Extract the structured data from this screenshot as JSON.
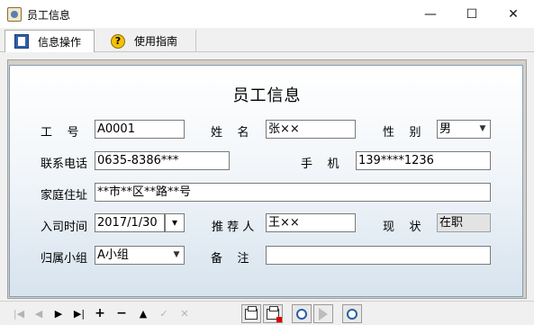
{
  "window": {
    "title": "员工信息",
    "minimize": "—",
    "maximize": "☐",
    "close": "✕"
  },
  "tabs": [
    {
      "label": "信息操作",
      "icon": "book-icon"
    },
    {
      "label": "使用指南",
      "icon": "help-icon",
      "glyph": "?"
    }
  ],
  "form": {
    "title": "员工信息",
    "labels": {
      "emp_id": "工    号",
      "name": "姓    名",
      "gender": "性    别",
      "phone": "联系电话",
      "mobile": "手    机",
      "address": "家庭住址",
      "hire_date": "入司时间",
      "referrer": "推 荐 人",
      "status": "现    状",
      "group": "归属小组",
      "remark": "备    注"
    },
    "values": {
      "emp_id": "A0001",
      "name": "张××",
      "gender": "男",
      "phone": "0635-8386***",
      "mobile": "139****1236",
      "address": "**市**区**路**号",
      "hire_date": "2017/1/30",
      "referrer": "王××",
      "status": "在职",
      "group": "A小组",
      "remark": ""
    }
  },
  "navigator": {
    "first": "|◀",
    "prior": "◀",
    "next": "▶",
    "last": "▶|",
    "insert": "+",
    "delete": "−",
    "edit": "▲",
    "post": "✓",
    "cancel": "✕"
  }
}
